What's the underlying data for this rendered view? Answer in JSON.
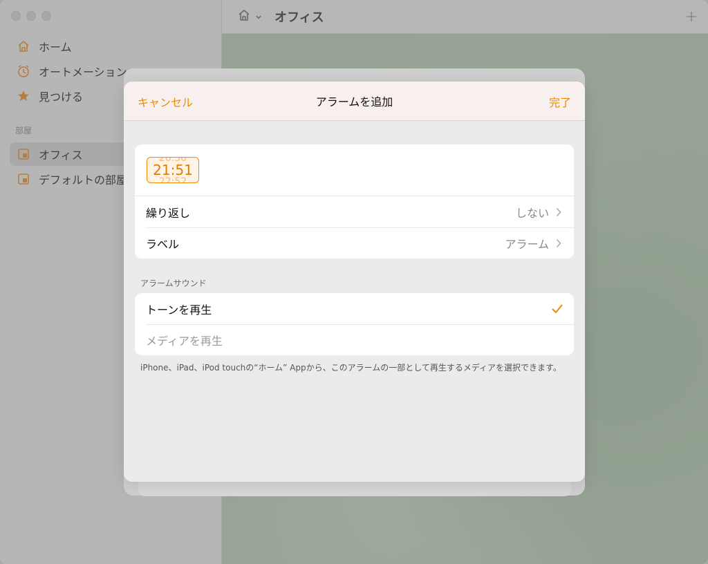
{
  "app": {
    "sidebar": {
      "items": [
        {
          "label": "ホーム",
          "icon": "house-icon"
        },
        {
          "label": "オートメーション",
          "icon": "clock-icon"
        },
        {
          "label": "見つける",
          "icon": "star-icon"
        }
      ],
      "section_title": "部屋",
      "rooms": [
        {
          "label": "オフィス",
          "icon": "room-icon",
          "selected": true
        },
        {
          "label": "デフォルトの部屋",
          "icon": "room-icon",
          "selected": false
        }
      ]
    },
    "toolbar": {
      "room_title": "オフィス",
      "home_icon": "house-icon",
      "add_icon": "plus-icon"
    }
  },
  "modal": {
    "title": "アラームを追加",
    "cancel_label": "キャンセル",
    "done_label": "完了",
    "time": {
      "value": "21:51",
      "above": "20:50",
      "below": "22:52"
    },
    "rows": [
      {
        "label": "繰り返し",
        "value": "しない"
      },
      {
        "label": "ラベル",
        "value": "アラーム"
      }
    ],
    "sound_section_title": "アラームサウンド",
    "sound_options": [
      {
        "label": "トーンを再生",
        "selected": true
      },
      {
        "label": "メディアを再生",
        "selected": false
      }
    ],
    "footnote": "iPhone、iPad、iPod touchの“ホーム” Appから、このアラームの一部として再生するメディアを選択できます。"
  },
  "colors": {
    "accent": "#f08a00",
    "header_bg": "#f8f0ee",
    "sheet_bg": "#ebebeb"
  }
}
